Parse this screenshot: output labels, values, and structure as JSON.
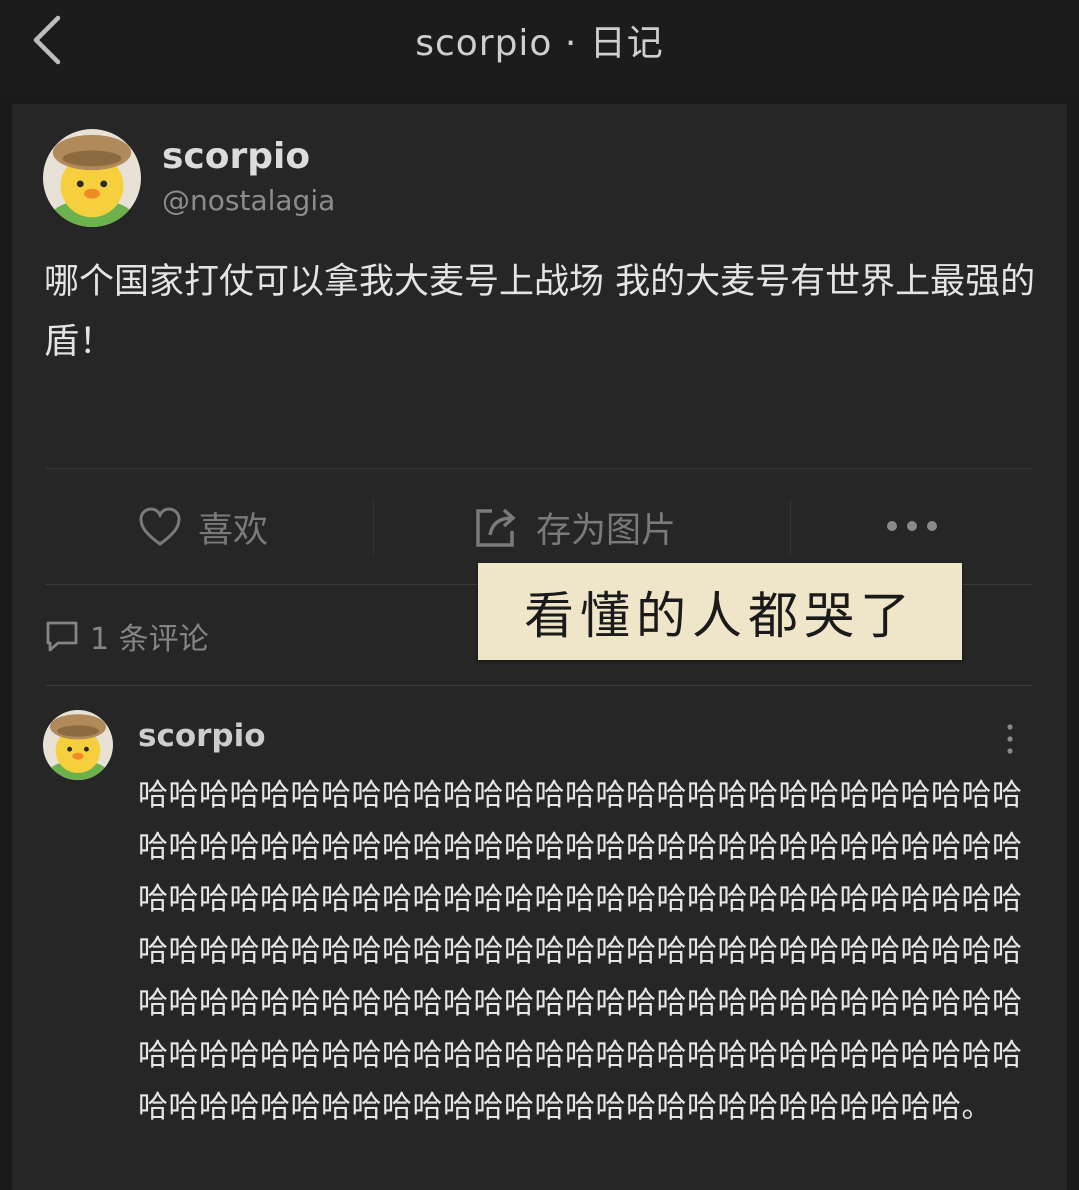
{
  "nav": {
    "title": "scorpio · 日记",
    "back_icon": "chevron-left-icon"
  },
  "post": {
    "author_name": "scorpio",
    "author_handle": "@nostalagia",
    "avatar_icon": "duck-avatar",
    "body": "哪个国家打仗可以拿我大麦号上战场 我的大麦号有世界上最强的盾！"
  },
  "actions": {
    "like_label": "喜欢",
    "like_icon": "heart-icon",
    "save_label": "存为图片",
    "save_icon": "share-icon",
    "more_icon": "more-dots-icon"
  },
  "comments": {
    "count_label": "1 条评论",
    "icon": "comment-icon",
    "items": [
      {
        "author": "scorpio",
        "text": "哈哈哈哈哈哈哈哈哈哈哈哈哈哈哈哈哈哈哈哈哈哈哈哈哈哈哈哈哈哈哈哈哈哈哈哈哈哈哈哈哈哈哈哈哈哈哈哈哈哈哈哈哈哈哈哈哈哈哈哈哈哈哈哈哈哈哈哈哈哈哈哈哈哈哈哈哈哈哈哈哈哈哈哈哈哈哈哈哈哈哈哈哈哈哈哈哈哈哈哈哈哈哈哈哈哈哈哈哈哈哈哈哈哈哈哈哈哈哈哈哈哈哈哈哈哈哈哈哈哈哈哈哈哈哈哈哈哈哈哈哈哈哈哈哈哈哈哈哈哈哈哈哈哈哈哈哈哈哈哈哈哈哈哈哈哈哈哈哈哈哈哈哈哈哈哈哈哈哈哈哈哈哈哈哈哈哈哈哈哈哈哈哈哈哈哈哈哈哈哈哈。"
      }
    ]
  },
  "sticker": {
    "text": "看懂的人都哭了"
  },
  "colors": {
    "background": "#1a1a1b",
    "card": "#262627",
    "sticker": "#efe5c8"
  }
}
